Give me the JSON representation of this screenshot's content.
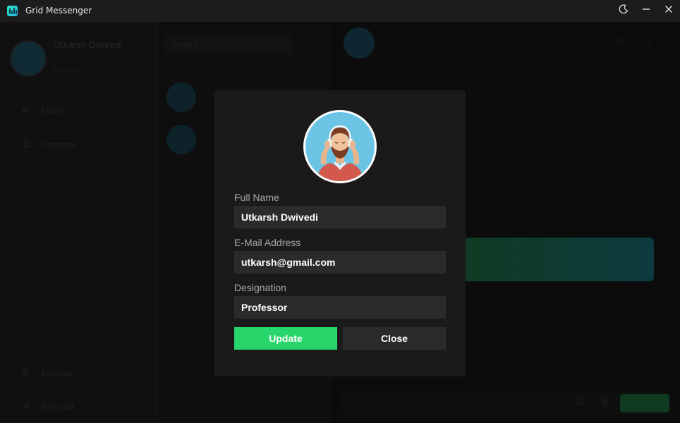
{
  "window": {
    "title": "Grid Messenger",
    "controls": {
      "theme_icon": "moon-icon",
      "minimize_icon": "minimize-icon",
      "close_icon": "close-icon"
    }
  },
  "sidebar": {
    "user_name": "Utkarsh Dwivedi",
    "user_status": "Online",
    "items": [
      {
        "label": "Chats",
        "icon": "chat-icon"
      },
      {
        "label": "Contacts",
        "icon": "contacts-icon"
      },
      {
        "label": "Settings",
        "icon": "gear-icon"
      },
      {
        "label": "Sign Out",
        "icon": "logout-icon"
      }
    ]
  },
  "chat_list": {
    "search_placeholder": "Search",
    "rows": [
      {
        "name": "",
        "preview": ""
      },
      {
        "name": "",
        "preview": ""
      }
    ]
  },
  "conversation": {
    "contact_name": "",
    "contact_status": ""
  },
  "profile_dialog": {
    "avatar_icon": "user-avatar-icon",
    "fields": [
      {
        "label": "Full Name",
        "value": "Utkarsh Dwivedi"
      },
      {
        "label": "E-Mail Address",
        "value": "utkarsh@gmail.com"
      },
      {
        "label": "Designation",
        "value": "Professor"
      }
    ],
    "update_label": "Update",
    "close_label": "Close"
  },
  "colors": {
    "accent": "#28d56b",
    "dialog_bg": "#1a1a1a",
    "input_bg": "#2b2b2b",
    "titlebar_bg": "#1c1c1c"
  }
}
